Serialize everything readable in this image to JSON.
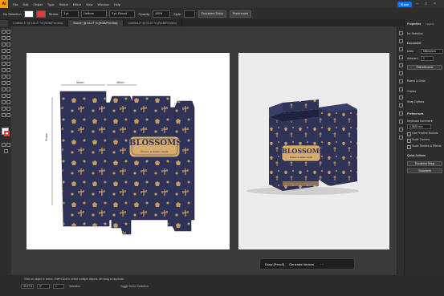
{
  "menubar": {
    "logo": "Ai",
    "items": [
      "File",
      "Edit",
      "Object",
      "Type",
      "Select",
      "Effect",
      "View",
      "Window",
      "Help"
    ],
    "share_label": "Share"
  },
  "controlbar": {
    "selection_label": "No Selection",
    "stroke_label": "Stroke:",
    "stroke_value": "1 pt",
    "uniform_label": "Uniform",
    "basic_label": "5 pt. Round",
    "opacity_label": "Opacity:",
    "opacity_value": "100%",
    "style_label": "Style:",
    "doc_setup": "Document Setup",
    "preferences": "Preferences"
  },
  "tabs": [
    {
      "label": "Untitled-1* @ 113.27 % (RGB/Preview)",
      "active": false
    },
    {
      "label": "Boxes* @ 33.27 % (RGB/Preview)",
      "active": true
    },
    {
      "label": "Untitled-2* @ 33.27 % (RGB/Preview)",
      "active": false
    }
  ],
  "artboard": {
    "dieline_label": "BLOSSOMS",
    "dieline_sub": "Flowers & Garden Goods",
    "dim_top1": "58mm",
    "dim_top2": "48mm",
    "dim_side": "90mm"
  },
  "mockup": {
    "label": "BLOSSOMS",
    "sub": "Flowers & Garden Goods"
  },
  "taskbar": {
    "draw_label": "Draw (Pencil)",
    "generate_label": "Generate Vectors"
  },
  "rightpanel": {
    "tabs": [
      "Properties",
      "Layers",
      "Libraries"
    ],
    "no_selection": "No Selection",
    "document_head": "Document",
    "units_label": "Units",
    "units_value": "Millimeters",
    "artboard_label": "Artboard",
    "artboard_value": "1",
    "edit_artboards": "Edit Artboards",
    "ruler_grids": "Rulers & Grids",
    "guides": "Guides",
    "snap_options": "Snap Options",
    "preferences_head": "Preferences",
    "keyboard_increment": "Keyboard Increment",
    "keyboard_value": "0.3528 mm",
    "use_preview_bounds": "Use Preview Bounds",
    "scale_corners": "Scale Corners",
    "scale_strokes": "Scale Strokes & Effects",
    "quick_actions": "Quick Actions",
    "document_setup": "Document Setup",
    "doc_btn": "Document"
  },
  "statusbar": {
    "zoom": "33.27%",
    "angle": "0°",
    "artboard_num": "1",
    "tool": "Selection",
    "hint": "Click on object to select. Shift+Click to select multiple objects. Alt+drag to duplicate.",
    "toggle_label": "Toggle Direct Selection"
  },
  "colors": {
    "pattern_bg": "#2f3358",
    "pattern_gold": "#c99a5b",
    "accent": "#1473e6",
    "brand": "#FF9A00"
  }
}
